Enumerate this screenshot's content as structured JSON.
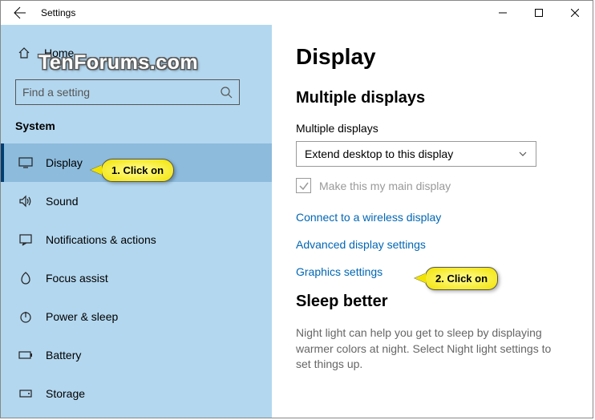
{
  "titlebar": {
    "title": "Settings"
  },
  "sidebar": {
    "home_label": "Home",
    "search_placeholder": "Find a setting",
    "category": "System",
    "items": [
      {
        "label": "Display"
      },
      {
        "label": "Sound"
      },
      {
        "label": "Notifications & actions"
      },
      {
        "label": "Focus assist"
      },
      {
        "label": "Power & sleep"
      },
      {
        "label": "Battery"
      },
      {
        "label": "Storage"
      }
    ]
  },
  "main": {
    "h1": "Display",
    "section1_h2": "Multiple displays",
    "dropdown_label": "Multiple displays",
    "dropdown_value": "Extend desktop to this display",
    "checkbox_label": "Make this my main display",
    "link_wireless": "Connect to a wireless display",
    "link_advanced": "Advanced display settings",
    "link_graphics": "Graphics settings",
    "section2_h2": "Sleep better",
    "sleep_desc": "Night light can help you get to sleep by displaying warmer colors at night. Select Night light settings to set things up."
  },
  "callouts": {
    "c1": "1. Click on",
    "c2": "2. Click on"
  },
  "watermark": "TenForums.com"
}
